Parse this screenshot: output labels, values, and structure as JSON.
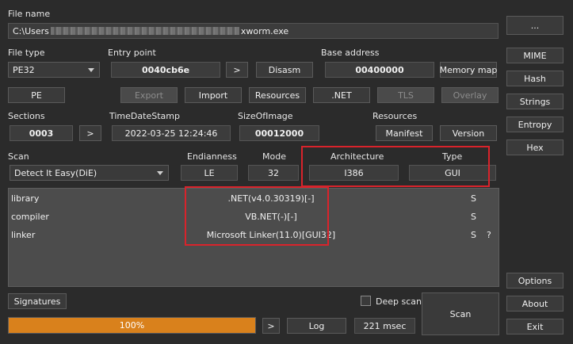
{
  "file": {
    "label": "File name",
    "path_prefix": "C:\\Users",
    "path_suffix": "xworm.exe",
    "browse_label": "..."
  },
  "filetype": {
    "label": "File type",
    "value": "PE32"
  },
  "entry_point": {
    "label": "Entry point",
    "value": "0040cb6e",
    "go_label": ">",
    "disasm_label": "Disasm"
  },
  "base_address": {
    "label": "Base address",
    "value": "00400000",
    "memory_map_label": "Memory map"
  },
  "toolbar": {
    "pe": "PE",
    "export": "Export",
    "import": "Import",
    "resources": "Resources",
    "net": ".NET",
    "tls": "TLS",
    "overlay": "Overlay"
  },
  "sections": {
    "label": "Sections",
    "value": "0003",
    "go_label": ">"
  },
  "timestamp": {
    "label": "TimeDateStamp",
    "value": "2022-03-25 12:24:46"
  },
  "size_of_image": {
    "label": "SizeOfImage",
    "value": "00012000"
  },
  "resources_group": {
    "label": "Resources",
    "manifest": "Manifest",
    "version": "Version"
  },
  "scan": {
    "label": "Scan",
    "engine": "Detect It Easy(DiE)",
    "endianness_label": "Endianness",
    "endianness": "LE",
    "mode_label": "Mode",
    "mode": "32",
    "arch_label": "Architecture",
    "arch": "I386",
    "type_label": "Type",
    "type": "GUI"
  },
  "results": [
    {
      "kind": "library",
      "value": ".NET(v4.0.30319)[-]",
      "flag": "S",
      "extra": ""
    },
    {
      "kind": "compiler",
      "value": "VB.NET(-)[-]",
      "flag": "S",
      "extra": ""
    },
    {
      "kind": "linker",
      "value": "Microsoft Linker(11.0)[GUI32]",
      "flag": "S",
      "extra": "?"
    }
  ],
  "bottom": {
    "signatures": "Signatures",
    "deep_scan": "Deep scan",
    "deep_scan_checked": false,
    "progress_text": "100%",
    "progress_fraction": 1.0,
    "go_label": ">",
    "log": "Log",
    "time": "221 msec",
    "scan_button": "Scan"
  },
  "right_panel": {
    "mime": "MIME",
    "hash": "Hash",
    "strings": "Strings",
    "entropy": "Entropy",
    "hex": "Hex",
    "options": "Options",
    "about": "About",
    "exit": "Exit"
  },
  "colors": {
    "accent_progress": "#d9811c",
    "highlight_red": "#d9232b",
    "background": "#2b2b2b"
  }
}
